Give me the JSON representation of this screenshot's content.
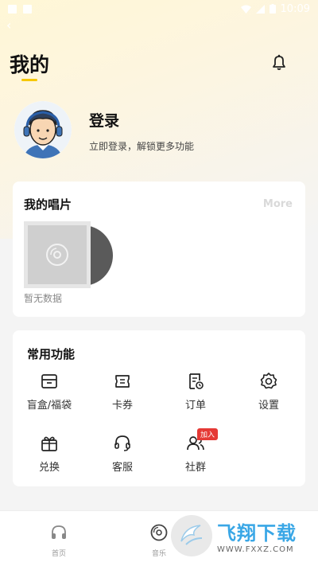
{
  "status_bar": {
    "time": "10:09"
  },
  "header": {
    "title": "我的"
  },
  "profile": {
    "login_title": "登录",
    "login_subtitle": "立即登录，解锁更多功能"
  },
  "records": {
    "title": "我的唱片",
    "more_label": "More",
    "empty_text": "暂无数据"
  },
  "features": {
    "title": "常用功能",
    "items": [
      {
        "label": "盲盒/福袋",
        "icon": "box-icon"
      },
      {
        "label": "卡券",
        "icon": "ticket-icon"
      },
      {
        "label": "订单",
        "icon": "order-icon"
      },
      {
        "label": "设置",
        "icon": "gear-icon"
      },
      {
        "label": "兑换",
        "icon": "gift-exchange-icon"
      },
      {
        "label": "客服",
        "icon": "headset-icon"
      },
      {
        "label": "社群",
        "icon": "community-icon",
        "badge": "加入"
      }
    ]
  },
  "tabbar": {
    "tabs": [
      {
        "label": "首页",
        "icon": "headphones-icon"
      },
      {
        "label": "音乐",
        "icon": "vinyl-icon"
      }
    ]
  },
  "watermark": {
    "main": "飞翔下载",
    "url": "WWW.FXXZ.COM"
  },
  "colors": {
    "accent": "#f6c800",
    "badge": "#e53935",
    "watermark_blue": "#3aa7e6"
  }
}
